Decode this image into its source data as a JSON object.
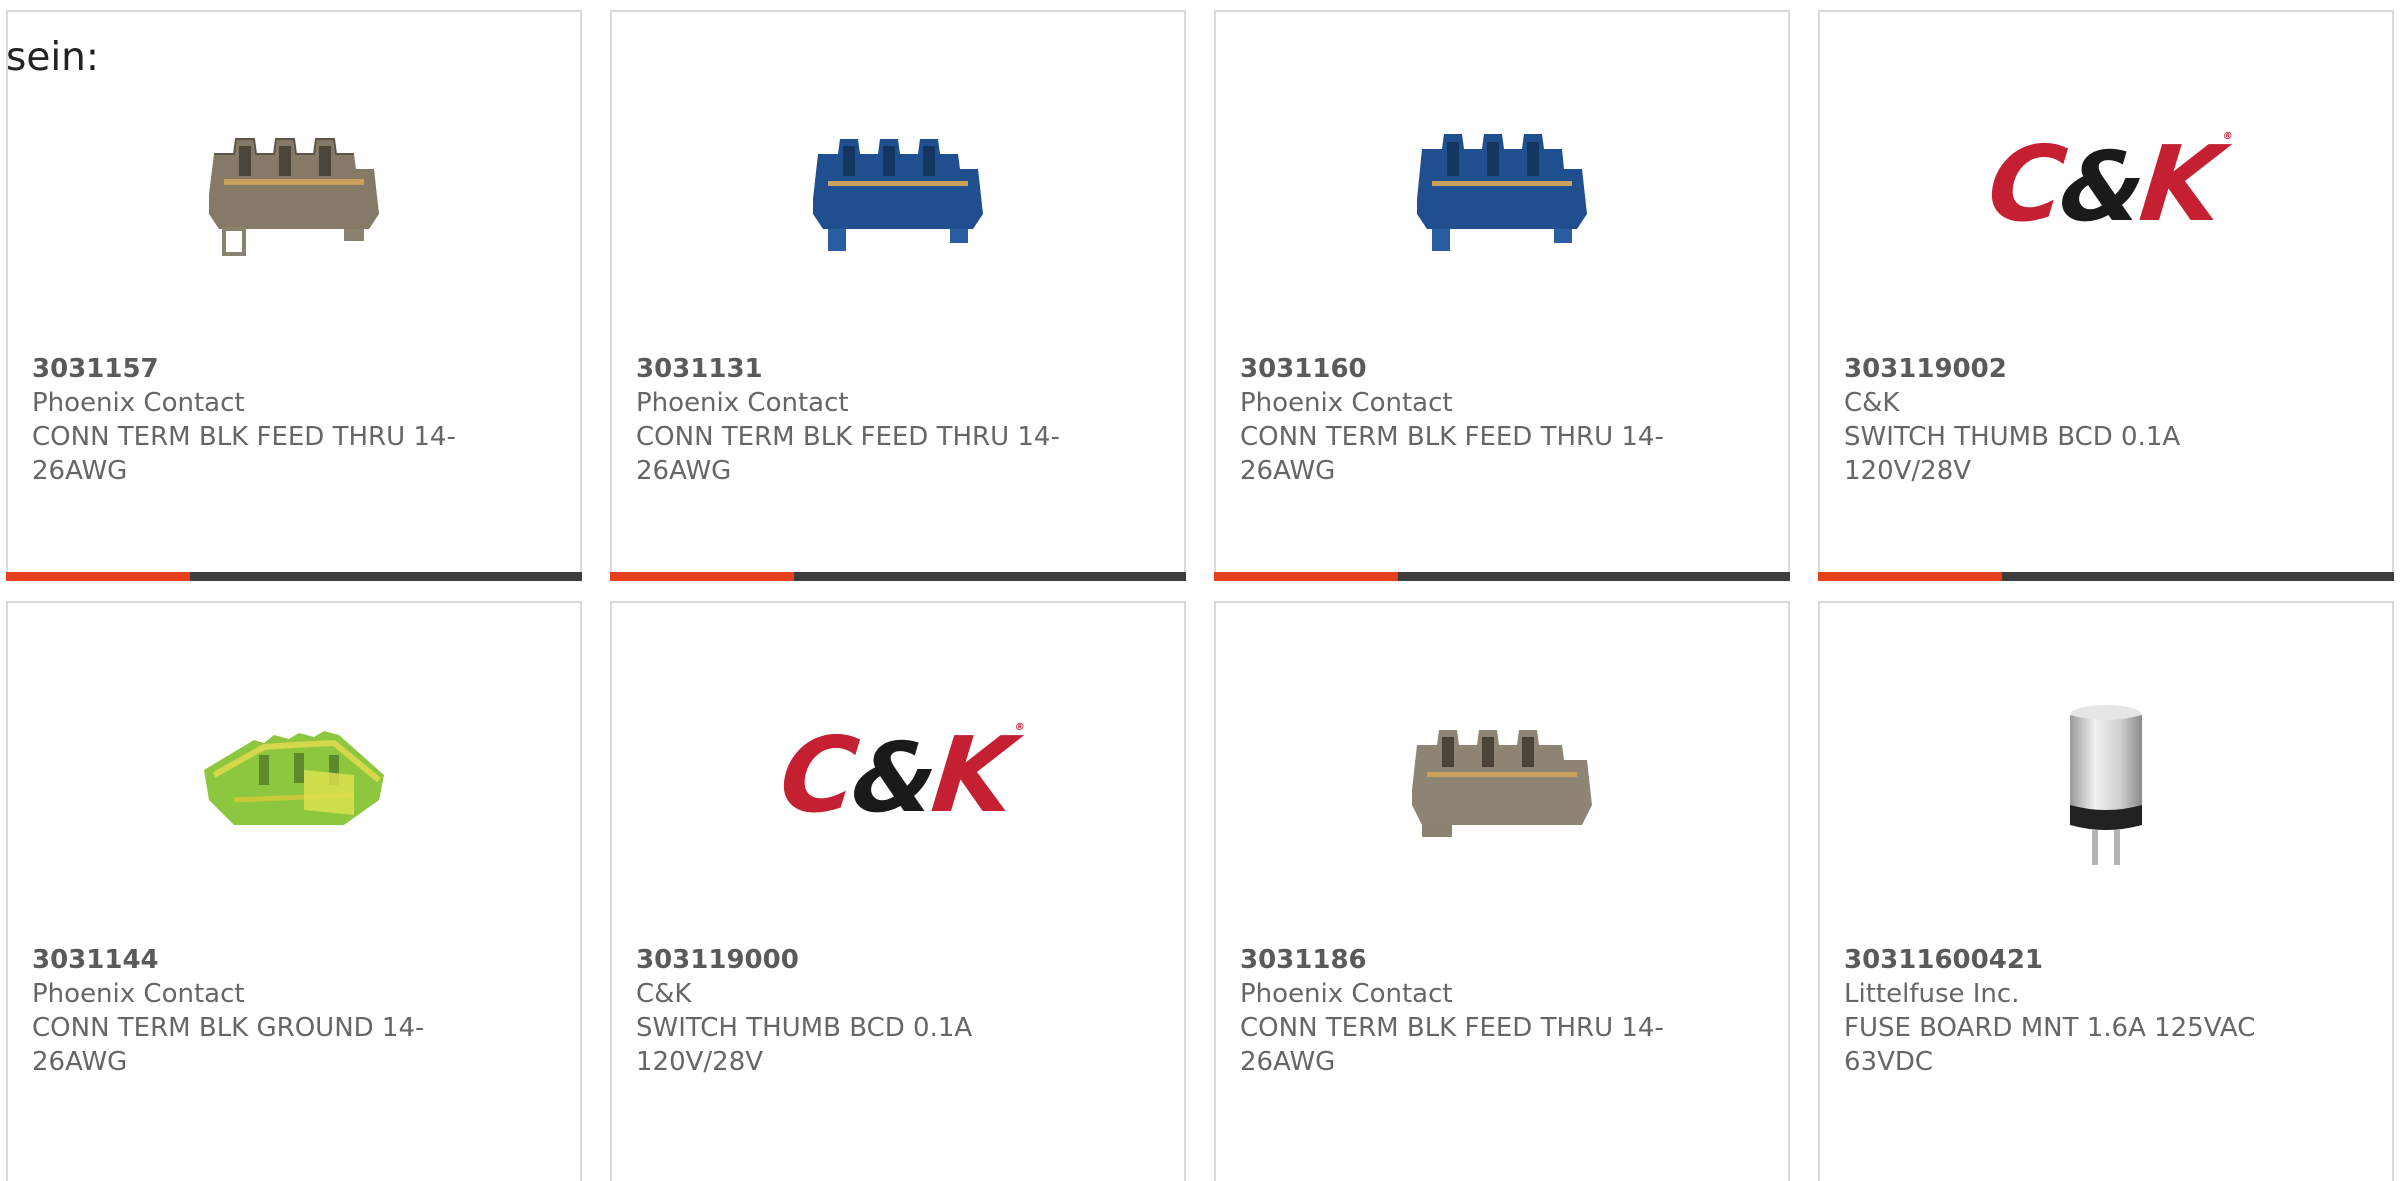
{
  "intro_text": "sein:",
  "brand_colors": {
    "accent": "#e8401c",
    "bar": "#3c3d3e",
    "ck_red": "#c42032"
  },
  "logo": {
    "c": "C",
    "amp": "&",
    "k": "K",
    "tm": "®"
  },
  "products": [
    {
      "part_number": "3031157",
      "manufacturer": "Phoenix Contact",
      "description": "CONN TERM BLK FEED THRU 14-26AWG",
      "image": "terminal-block-gray-icon"
    },
    {
      "part_number": "3031131",
      "manufacturer": "Phoenix Contact",
      "description": "CONN TERM BLK FEED THRU 14-26AWG",
      "image": "terminal-block-blue-icon"
    },
    {
      "part_number": "3031160",
      "manufacturer": "Phoenix Contact",
      "description": "CONN TERM BLK FEED THRU 14-26AWG",
      "image": "terminal-block-blue-icon"
    },
    {
      "part_number": "303119002",
      "manufacturer": "C&K",
      "description": "SWITCH THUMB BCD 0.1A 120V/28V",
      "image": "ck-logo"
    },
    {
      "part_number": "3031144",
      "manufacturer": "Phoenix Contact",
      "description": "CONN TERM BLK GROUND 14-26AWG",
      "image": "terminal-block-green-yellow-icon"
    },
    {
      "part_number": "303119000",
      "manufacturer": "C&K",
      "description": "SWITCH THUMB BCD 0.1A 120V/28V",
      "image": "ck-logo"
    },
    {
      "part_number": "3031186",
      "manufacturer": "Phoenix Contact",
      "description": "CONN TERM BLK FEED THRU 14-26AWG",
      "image": "terminal-block-gray-icon"
    },
    {
      "part_number": "30311600421",
      "manufacturer": "Littelfuse Inc.",
      "description": "FUSE BOARD MNT 1.6A 125VAC 63VDC",
      "image": "fuse-icon"
    }
  ]
}
